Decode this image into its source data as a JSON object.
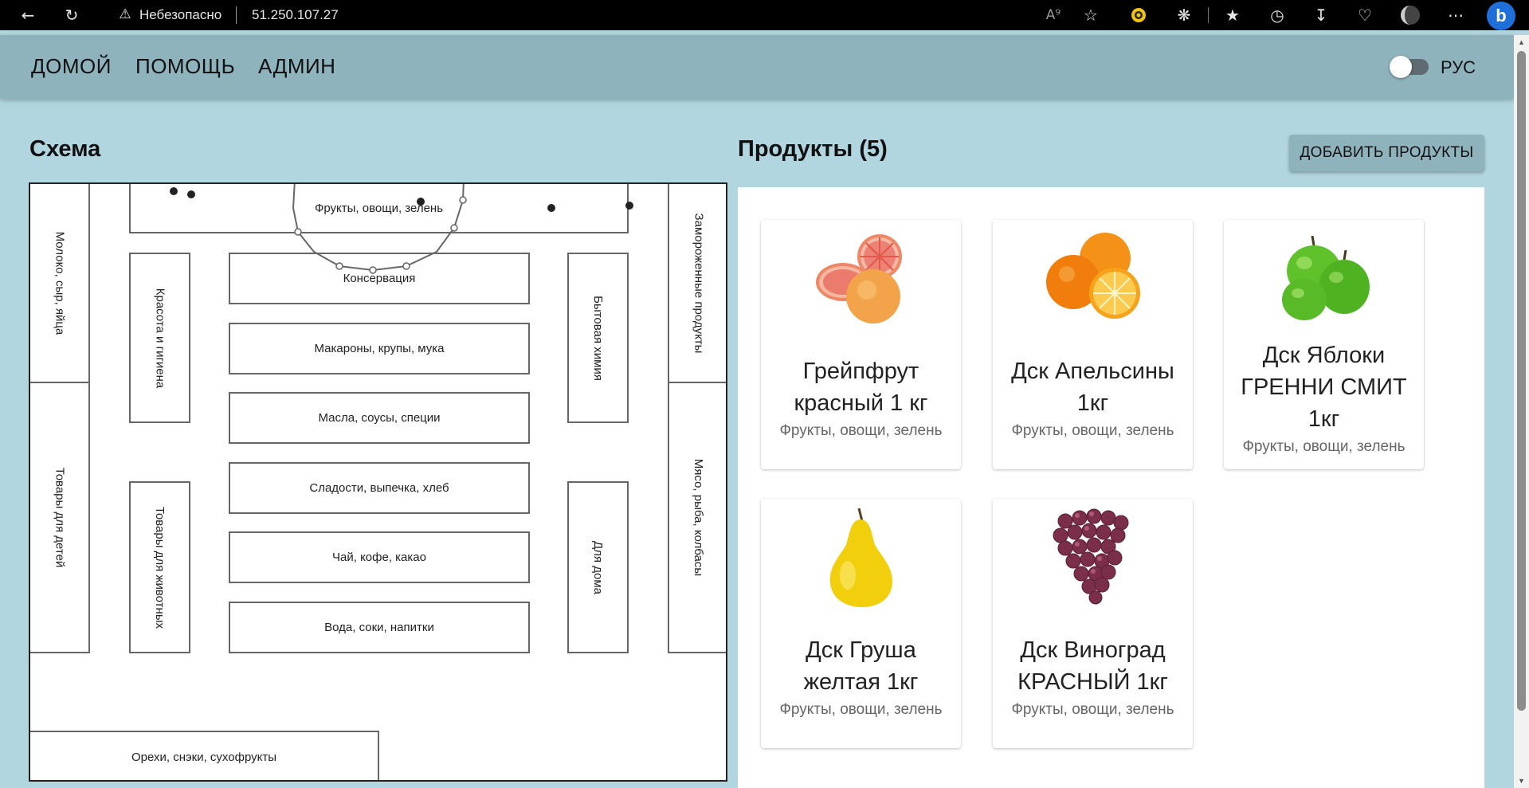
{
  "browser": {
    "security_label": "Небезопасно",
    "url": "51.250.107.27",
    "read_aloud_label": "A⁹"
  },
  "nav": {
    "items": [
      "ДОМОЙ",
      "ПОМОЩЬ",
      "АДМИН"
    ],
    "language": "РУС"
  },
  "scheme": {
    "title": "Схема",
    "zones": {
      "fruits": "Фрукты, овощи, зелень",
      "dairy": "Молоко, сыр, яйца",
      "kids": "Товары для детей",
      "frozen": "Замороженные продукты",
      "meat": "Мясо, рыба, колбасы",
      "beauty": "Красота и гигиена",
      "pets": "Товары для животных",
      "household": "Бытовая химия",
      "home": "Для дома",
      "canned": "Консервация",
      "pasta": "Макароны, крупы, мука",
      "oils": "Масла, соусы, специи",
      "sweets": "Сладости, выпечка, хлеб",
      "tea": "Чай, кофе, какао",
      "water": "Вода, соки, напитки",
      "nuts": "Орехи, снэки, сухофрукты"
    }
  },
  "products": {
    "title": "Продукты (5)",
    "add_button": "ДОБАВИТЬ ПРОДУКТЫ",
    "items": [
      {
        "name": "Грейпфрут красный 1 кг",
        "category": "Фрукты, овощи, зелень",
        "image": "grapefruit"
      },
      {
        "name": "Дск Апельсины 1кг",
        "category": "Фрукты, овощи, зелень",
        "image": "orange"
      },
      {
        "name": "Дск Яблоки ГРЕННИ СМИТ 1кг",
        "category": "Фрукты, овощи, зелень",
        "image": "green-apple"
      },
      {
        "name": "Дск Груша желтая 1кг",
        "category": "Фрукты, овощи, зелень",
        "image": "yellow-pear"
      },
      {
        "name": "Дск Виноград КРАСНЫЙ 1кг",
        "category": "Фрукты, овощи, зелень",
        "image": "red-grapes"
      }
    ]
  },
  "colors": {
    "app_bar": "#8fb3bd",
    "background": "#b2d6df"
  }
}
